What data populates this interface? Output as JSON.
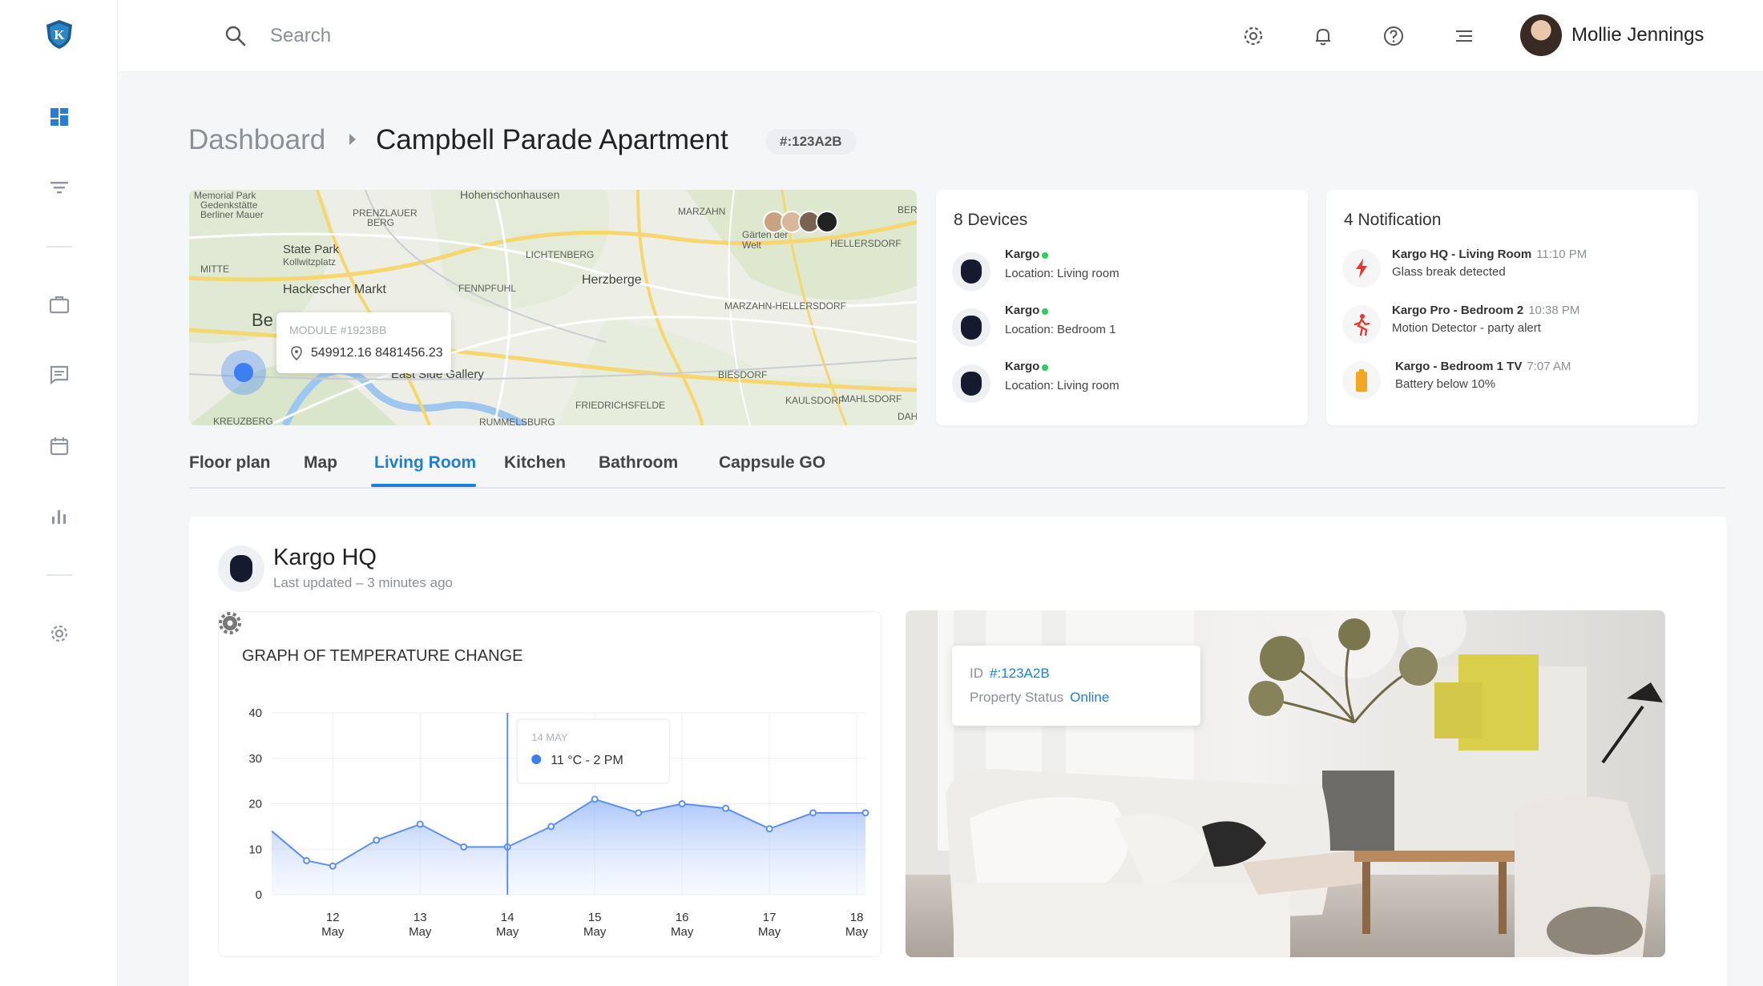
{
  "topbar": {
    "search_placeholder": "Search",
    "user_name": "Mollie Jennings"
  },
  "sidebar": {
    "items": [
      {
        "icon": "dashboard-icon",
        "active": true
      },
      {
        "icon": "filter-icon"
      },
      {
        "icon": "briefcase-icon"
      },
      {
        "icon": "chat-icon"
      },
      {
        "icon": "calendar-icon"
      },
      {
        "icon": "bar-chart-icon"
      },
      {
        "icon": "gear-icon"
      }
    ]
  },
  "breadcrumb": {
    "root": "Dashboard",
    "current": "Campbell Parade Apartment",
    "badge": "#:123A2B"
  },
  "map": {
    "labels": [
      "Memorial Park",
      "Gedenkstätte",
      "Berliner Mauer",
      "PRENZLAUER",
      "BERG",
      "State Park",
      "Kollwitzplatz",
      "MITTE",
      "Hackescher Markt",
      "Hohenschonhausen",
      "LICHTENBERG",
      "Herzberge",
      "MARZAHN",
      "HELLERSDORF",
      "Gärten der Welt",
      "FENNPFUHL",
      "MARZAHN-HELLERSDORF",
      "East Side Gallery",
      "FRIEDRICHSFELDE",
      "BIESDORF",
      "KAULSDORF",
      "MAHLSDORF",
      "KREUZBERG",
      "RUMMELSBURG",
      "Be",
      "DAH",
      "BER"
    ],
    "popup": {
      "module": "MODULE #1923BB",
      "coords": "549912.16 8481456.23"
    }
  },
  "devices": {
    "title": "8 Devices",
    "items": [
      {
        "name": "Kargo",
        "location": "Location: Living room"
      },
      {
        "name": "Kargo",
        "location": "Location: Bedroom 1"
      },
      {
        "name": "Kargo",
        "location": "Location: Living room"
      }
    ]
  },
  "notifications": {
    "title": "4 Notification",
    "items": [
      {
        "title": "Kargo HQ - Living Room",
        "time": "11:10 PM",
        "desc": "Glass break detected",
        "icon": "lightning-icon",
        "color": "#e53935"
      },
      {
        "title": "Kargo Pro - Bedroom 2",
        "time": "10:38 PM",
        "desc": "Motion Detector - party alert",
        "icon": "running-person-icon",
        "color": "#e53935"
      },
      {
        "title": "Kargo - Bedroom 1 TV",
        "time": "7:07 AM",
        "desc": "Battery below 10%",
        "icon": "battery-icon",
        "color": "#f4a623"
      }
    ]
  },
  "tabs": [
    "Floor plan",
    "Map",
    "Living Room",
    "Kitchen",
    "Bathroom",
    "Cappsule GO"
  ],
  "active_tab": "Living Room",
  "device_panel": {
    "title": "Kargo HQ",
    "subtitle": "Last updated – 3 minutes ago"
  },
  "graph": {
    "title": "GRAPH OF TEMPERATURE CHANGE",
    "tooltip_date": "14 MAY",
    "tooltip_value": "11 °C - 2 PM"
  },
  "chart_data": {
    "type": "area",
    "title": "GRAPH OF TEMPERATURE CHANGE",
    "xlabel": "",
    "ylabel": "",
    "ylim": [
      0,
      40
    ],
    "yticks": [
      0,
      10,
      20,
      30,
      40
    ],
    "xticks": [
      {
        "day": "12",
        "month": "May",
        "x": 12
      },
      {
        "day": "13",
        "month": "May",
        "x": 13
      },
      {
        "day": "14",
        "month": "May",
        "x": 14
      },
      {
        "day": "15",
        "month": "May",
        "x": 15
      },
      {
        "day": "16",
        "month": "May",
        "x": 16
      },
      {
        "day": "17",
        "month": "May",
        "x": 17
      },
      {
        "day": "18",
        "month": "May",
        "x": 18
      }
    ],
    "xlim": [
      11.3,
      18.1
    ],
    "points": [
      {
        "x": 11.3,
        "y": 14
      },
      {
        "x": 11.7,
        "y": 7.5
      },
      {
        "x": 12.0,
        "y": 6.3
      },
      {
        "x": 12.5,
        "y": 12
      },
      {
        "x": 13.0,
        "y": 15.5
      },
      {
        "x": 13.5,
        "y": 10.5
      },
      {
        "x": 14.0,
        "y": 10.5
      },
      {
        "x": 14.5,
        "y": 15
      },
      {
        "x": 15.0,
        "y": 21
      },
      {
        "x": 15.5,
        "y": 18
      },
      {
        "x": 16.0,
        "y": 20
      },
      {
        "x": 16.5,
        "y": 19
      },
      {
        "x": 17.0,
        "y": 14.5
      },
      {
        "x": 17.5,
        "y": 18
      },
      {
        "x": 18.1,
        "y": 18
      }
    ],
    "highlight_x": 14.0,
    "line_color": "#5b8ff5",
    "grid": true
  },
  "property": {
    "id_label": "ID",
    "id_value": "#:123A2B",
    "status_label": "Property Status",
    "status_value": "Online"
  },
  "colors": {
    "accent": "#1f7ed8",
    "online": "#2ecc5c"
  }
}
